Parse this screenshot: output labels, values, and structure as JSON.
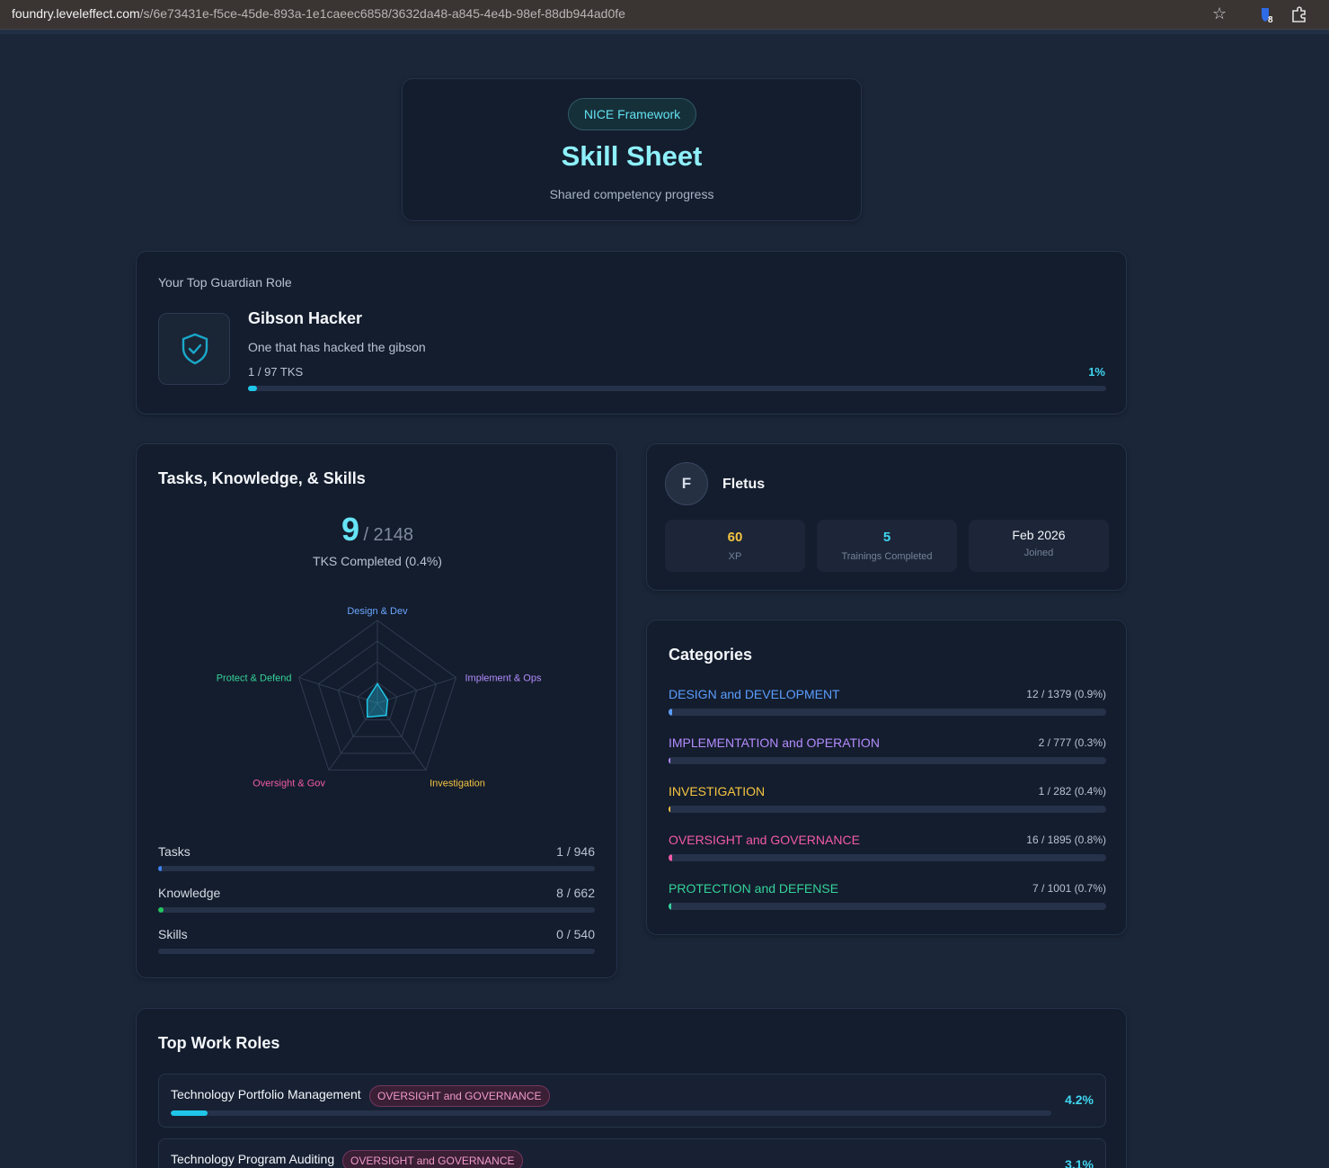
{
  "browser": {
    "url_host": "foundry.leveleffect.com",
    "url_path": "/s/6e73431e-f5ce-45de-893a-1e1caeec6858/3632da48-a845-4e4b-98ef-88db944ad0fe",
    "extension_badge": "8"
  },
  "header": {
    "pill": "NICE Framework",
    "title": "Skill Sheet",
    "subtitle": "Shared competency progress"
  },
  "guardian": {
    "label": "Your Top Guardian Role",
    "name": "Gibson Hacker",
    "description": "One that has hacked the gibson",
    "tks": "1 / 97 TKS",
    "percent": "1%",
    "progress": 0.01
  },
  "tks": {
    "title": "Tasks, Knowledge, & Skills",
    "completed": "9",
    "total": "/ 2148",
    "completed_label": "TKS Completed (0.4%)",
    "radar": {
      "axes": [
        "Design & Dev",
        "Implement & Ops",
        "Investigation",
        "Oversight & Gov",
        "Protect & Defend"
      ],
      "axis_colors": [
        "#6aa6ff",
        "#b38cff",
        "#f5c542",
        "#f25aa8",
        "#34d39a"
      ],
      "values": [
        0.09,
        0.05,
        0.07,
        0.08,
        0.05
      ]
    },
    "rows": [
      {
        "label": "Tasks",
        "value": "1 / 946",
        "progress": 0.001,
        "color": "#3b82f6"
      },
      {
        "label": "Knowledge",
        "value": "8 / 662",
        "progress": 0.012,
        "color": "#22c55e"
      },
      {
        "label": "Skills",
        "value": "0 / 540",
        "progress": 0,
        "color": "#a855f7"
      }
    ]
  },
  "user": {
    "initial": "F",
    "name": "Fletus",
    "xp_value": "60",
    "xp_label": "XP",
    "trainings_value": "5",
    "trainings_label": "Trainings Completed",
    "joined_value": "Feb 2026",
    "joined_label": "Joined"
  },
  "categories": {
    "title": "Categories",
    "items": [
      {
        "name": "DESIGN and DEVELOPMENT",
        "value": "12 / 1379 (0.9%)",
        "progress": 0.009,
        "color": "#5b9dff"
      },
      {
        "name": "IMPLEMENTATION and OPERATION",
        "value": "2 / 777 (0.3%)",
        "progress": 0.003,
        "color": "#b38cff"
      },
      {
        "name": "INVESTIGATION",
        "value": "1 / 282 (0.4%)",
        "progress": 0.004,
        "color": "#f5c542"
      },
      {
        "name": "OVERSIGHT and GOVERNANCE",
        "value": "16 / 1895 (0.8%)",
        "progress": 0.008,
        "color": "#f25aa8"
      },
      {
        "name": "PROTECTION and DEFENSE",
        "value": "7 / 1001 (0.7%)",
        "progress": 0.007,
        "color": "#34d39a"
      }
    ]
  },
  "work_roles": {
    "title": "Top Work Roles",
    "items": [
      {
        "name": "Technology Portfolio Management",
        "tag": "OVERSIGHT and GOVERNANCE",
        "percent": "4.2%",
        "progress": 0.042
      },
      {
        "name": "Technology Program Auditing",
        "tag": "OVERSIGHT and GOVERNANCE",
        "percent": "3.1%",
        "progress": 0.031
      }
    ]
  }
}
